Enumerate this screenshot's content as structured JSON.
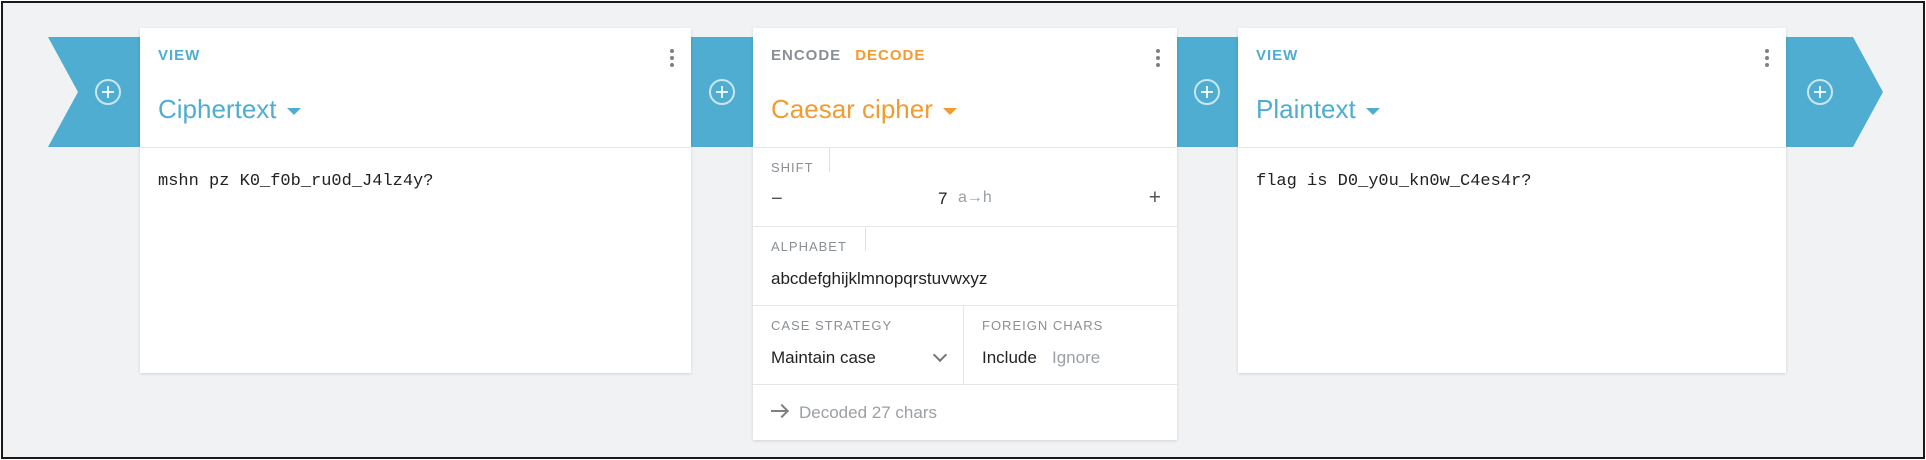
{
  "colors": {
    "accent_blue": "#4eadd0",
    "accent_orange": "#f39b2f",
    "background": "#f1f2f3"
  },
  "cards": [
    {
      "tabs": [
        "VIEW"
      ],
      "title": "Ciphertext",
      "content": "mshn pz K0_f0b_ru0d_J4lz4y?"
    },
    {
      "tabs": [
        "ENCODE",
        "DECODE"
      ],
      "active_tab": "DECODE",
      "title": "Caesar cipher",
      "shift": {
        "label": "SHIFT",
        "minus": "−",
        "value": "7",
        "mapping": "a→h",
        "plus": "+"
      },
      "alphabet": {
        "label": "ALPHABET",
        "value": "abcdefghijklmnopqrstuvwxyz"
      },
      "case_strategy": {
        "label": "CASE STRATEGY",
        "value": "Maintain case"
      },
      "foreign_chars": {
        "label": "FOREIGN CHARS",
        "options": [
          "Include",
          "Ignore"
        ],
        "selected": "Include"
      },
      "status": "Decoded 27 chars"
    },
    {
      "tabs": [
        "VIEW"
      ],
      "title": "Plaintext",
      "content": "flag is D0_y0u_kn0w_C4es4r?"
    }
  ],
  "icons": [
    "add-circle-icon",
    "kebab-menu-icon",
    "caret-down-icon",
    "chevron-down-icon",
    "arrow-right-icon"
  ]
}
